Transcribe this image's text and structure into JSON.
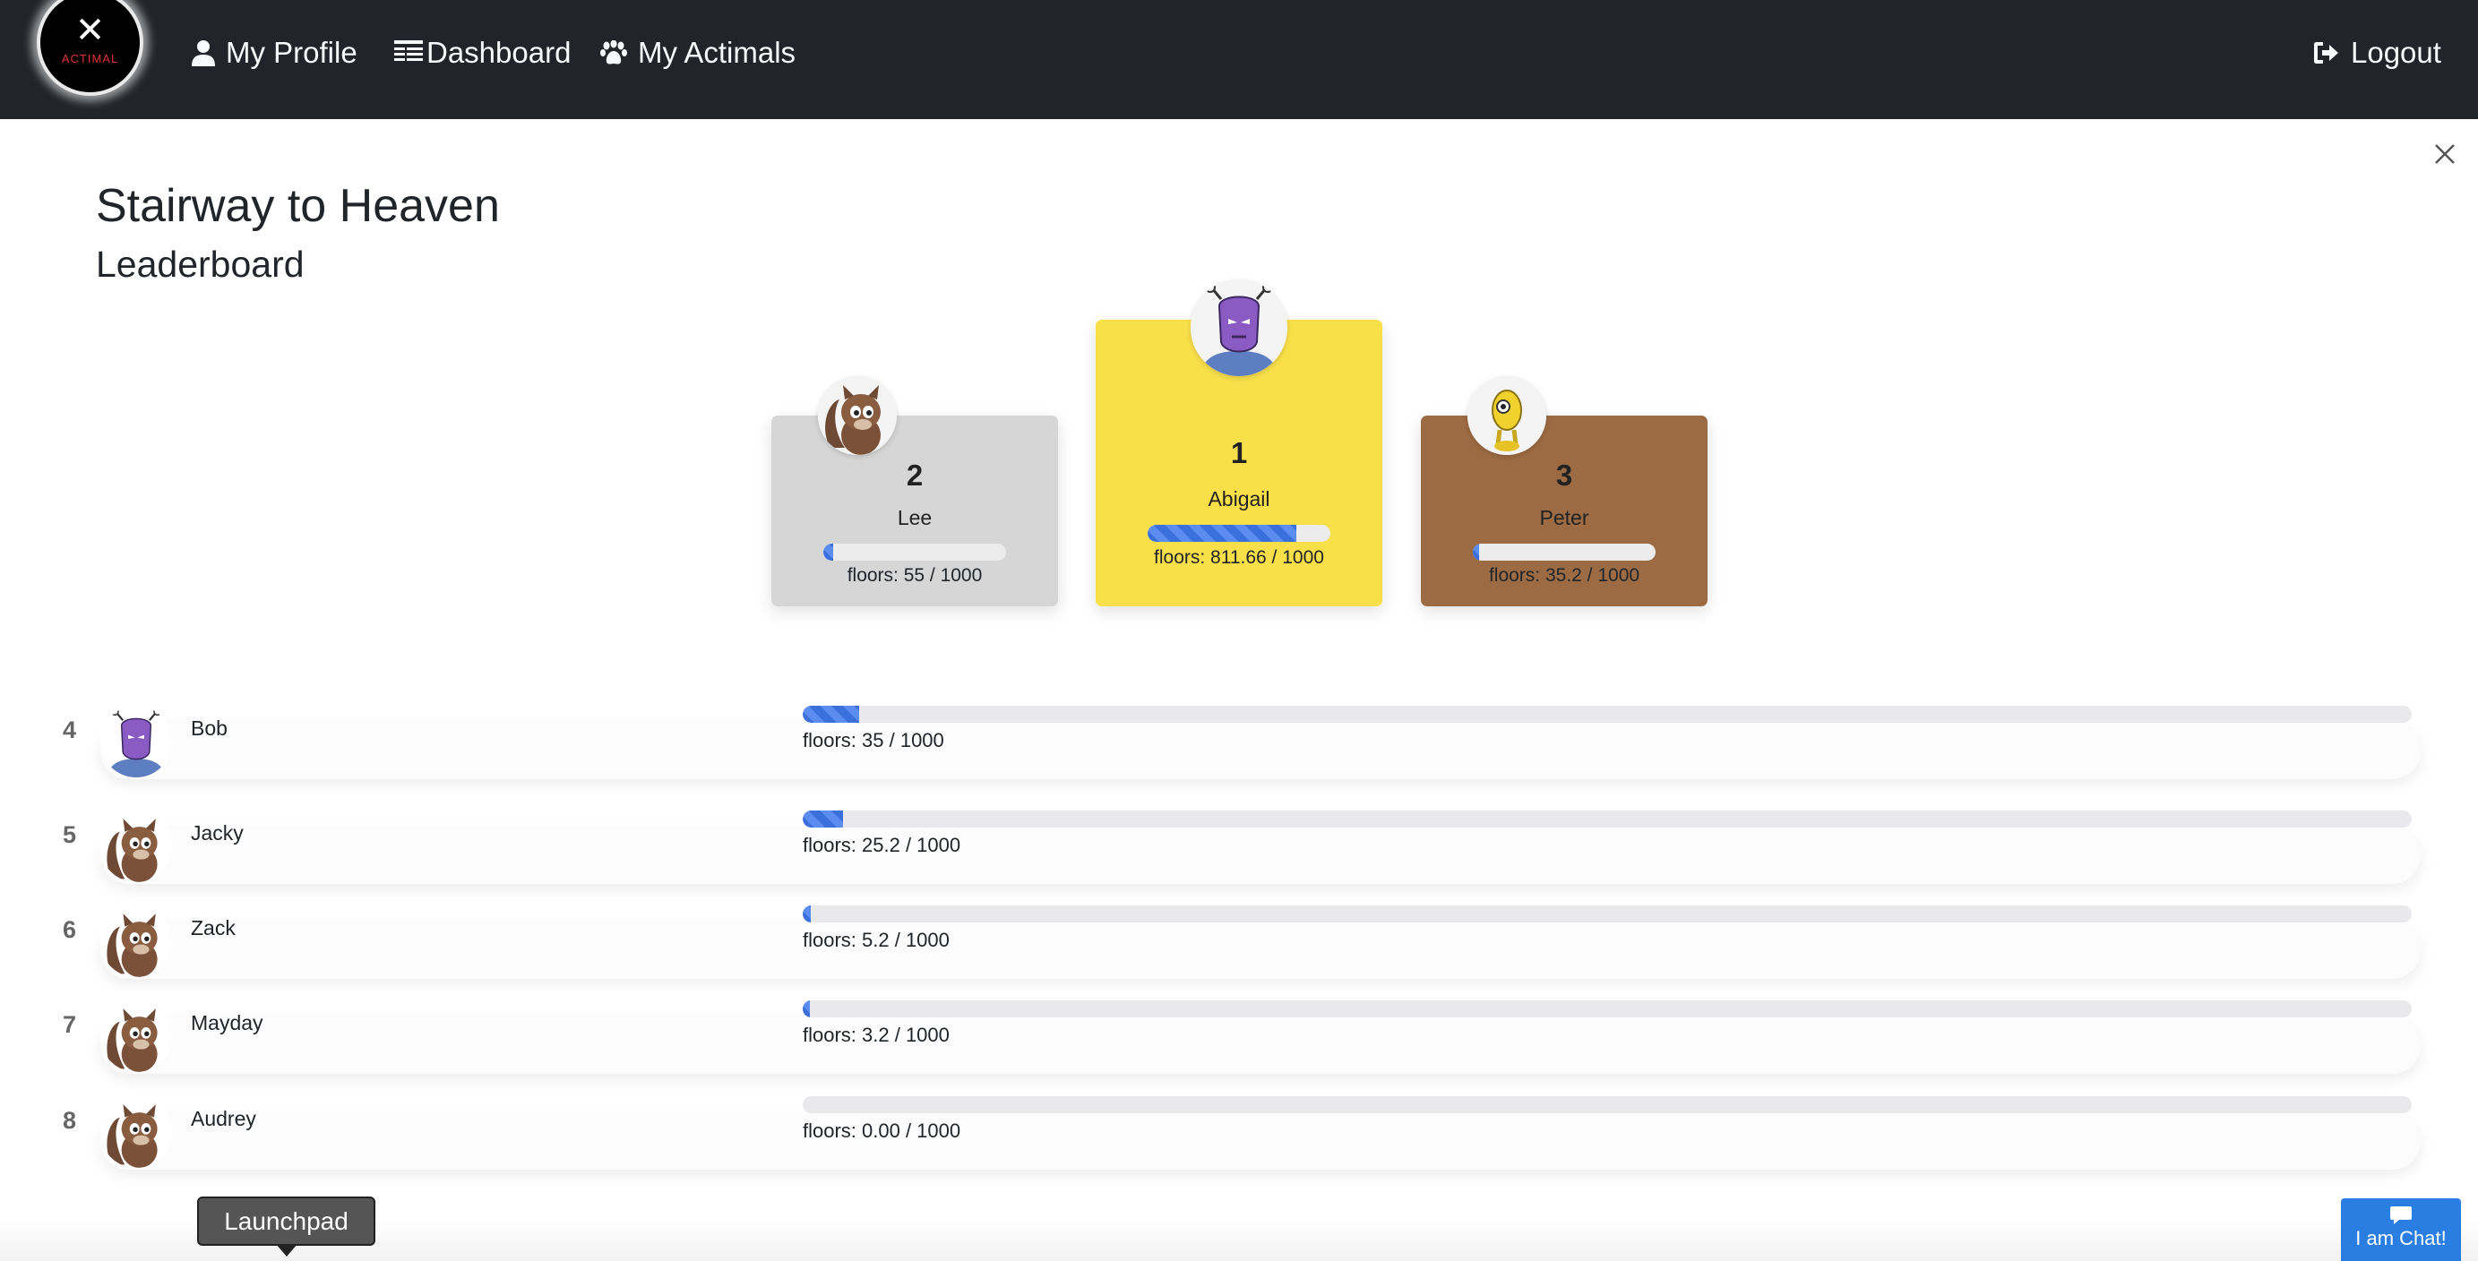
{
  "navbar": {
    "logo_mark": "✕",
    "logo_text": "ACTIMAL",
    "items": [
      {
        "label": "My Profile",
        "icon": "user-icon"
      },
      {
        "label": "Dashboard",
        "icon": "dashboard-icon"
      },
      {
        "label": "My Actimals",
        "icon": "paw-icon"
      }
    ],
    "logout": {
      "label": "Logout",
      "icon": "logout-icon"
    }
  },
  "page": {
    "title": "Stairway to Heaven",
    "subtitle": "Leaderboard"
  },
  "podium": [
    {
      "rank": "2",
      "name": "Lee",
      "floors": "floors: 55 / 1000",
      "progress": 0.055,
      "avatar": "squirrel-avatar"
    },
    {
      "rank": "1",
      "name": "Abigail",
      "floors": "floors: 811.66 / 1000",
      "progress": 0.81166,
      "avatar": "alien-avatar"
    },
    {
      "rank": "3",
      "name": "Peter",
      "floors": "floors: 35.2 / 1000",
      "progress": 0.0352,
      "avatar": "yellow-robot-avatar"
    }
  ],
  "list": [
    {
      "rank": "4",
      "name": "Bob",
      "floors": "floors: 35 / 1000",
      "progress": 0.035,
      "avatar": "alien-avatar"
    },
    {
      "rank": "5",
      "name": "Jacky",
      "floors": "floors: 25.2 / 1000",
      "progress": 0.0252,
      "avatar": "squirrel-avatar"
    },
    {
      "rank": "6",
      "name": "Zack",
      "floors": "floors: 5.2 / 1000",
      "progress": 0.0052,
      "avatar": "squirrel-avatar"
    },
    {
      "rank": "7",
      "name": "Mayday",
      "floors": "floors: 3.2 / 1000",
      "progress": 0.0032,
      "avatar": "squirrel-avatar"
    },
    {
      "rank": "8",
      "name": "Audrey",
      "floors": "floors: 0.00 / 1000",
      "progress": 0.0,
      "avatar": "squirrel-avatar"
    }
  ],
  "launchpad": {
    "label": "Launchpad"
  },
  "chat": {
    "label": "I am Chat!",
    "icon": "chat-icon"
  },
  "colors": {
    "navbar": "#212529",
    "gold": "#f9df4a",
    "silver": "#d6d6d6",
    "bronze": "#9c6b43",
    "progress": "#3a6fdc",
    "chat": "#2a7de1"
  }
}
